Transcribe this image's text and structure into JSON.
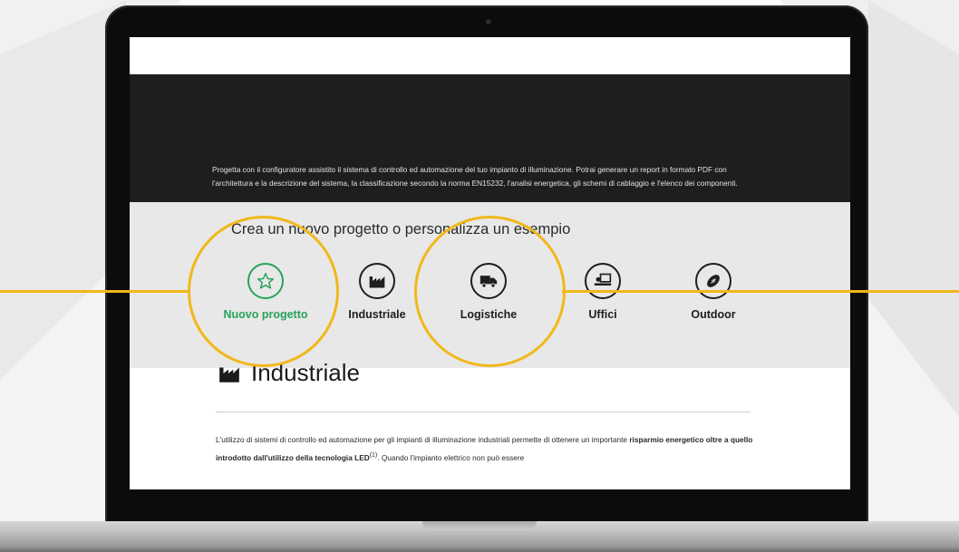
{
  "hero": {
    "description": "Progetta con il configuratore assistito il sistema di controllo ed automazione del tuo impianto di illuminazione. Potrai generare un report in formato PDF con l'architettura e la descrizione del sistema, la classificazione secondo la norma EN15232, l'analisi energetica, gli schemi di cablaggio e l'elenco dei componenti."
  },
  "picker": {
    "title": "Crea un nuovo progetto o personalizza un esempio",
    "options": [
      {
        "label": "Nuovo progetto",
        "icon": "star-icon",
        "active": true
      },
      {
        "label": "Industriale",
        "icon": "factory-icon",
        "active": false
      },
      {
        "label": "Logistiche",
        "icon": "truck-icon",
        "active": false
      },
      {
        "label": "Uffici",
        "icon": "office-desk-icon",
        "active": false
      },
      {
        "label": "Outdoor",
        "icon": "football-icon",
        "active": false
      }
    ]
  },
  "section": {
    "title": "Industriale",
    "text_before_bold": "L'utilizzo di sistemi di controllo ed automazione per gli impianti di illuminazione industriali permette di ottenere un importante",
    "bold_text": "risparmio energetico oltre a quello introdotto dall'utilizzo della tecnologia LED",
    "footnote": "(1)",
    "text_after": ". Quando l'impianto elettrico non può essere"
  },
  "colors": {
    "accent_green": "#27a35a",
    "highlight_yellow": "#f0b81a",
    "hero_background": "#1c1e1f",
    "picker_background": "#e8e8e8"
  }
}
